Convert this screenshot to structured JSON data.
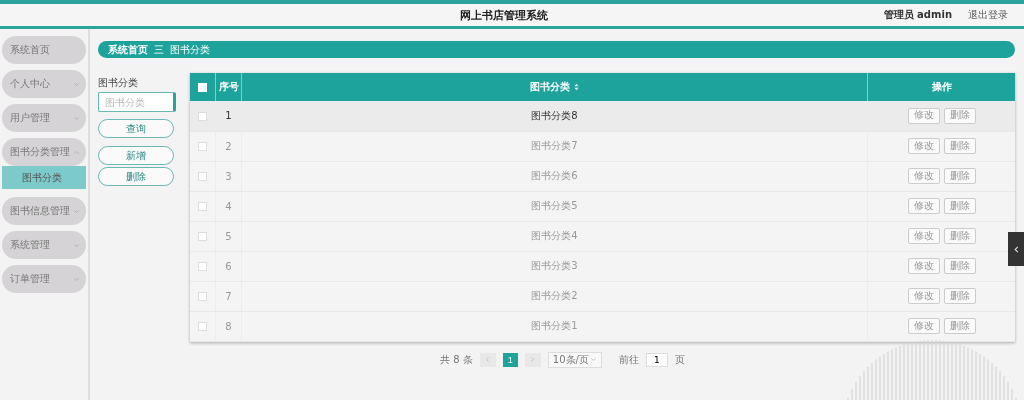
{
  "header": {
    "title": "网上书店管理系统",
    "user": "管理员 admin",
    "logout": "退出登录"
  },
  "sidebar": {
    "items": [
      {
        "label": "系统首页",
        "kind": "link"
      },
      {
        "label": "个人中心",
        "kind": "group",
        "expanded": false
      },
      {
        "label": "用户管理",
        "kind": "group",
        "expanded": false
      },
      {
        "label": "图书分类管理",
        "kind": "group",
        "expanded": true,
        "children": [
          {
            "label": "图书分类",
            "selected": true
          }
        ]
      },
      {
        "label": "图书信息管理",
        "kind": "group",
        "expanded": false
      },
      {
        "label": "系统管理",
        "kind": "group",
        "expanded": false
      },
      {
        "label": "订单管理",
        "kind": "group",
        "expanded": false
      }
    ]
  },
  "breadcrumb": [
    "系统首页",
    "图书分类"
  ],
  "breadcrumb_separator": "三",
  "search": {
    "label": "图书分类",
    "placeholder": "图书分类",
    "button": "查询"
  },
  "actions": [
    "新增",
    "删除"
  ],
  "table": {
    "all_checked": false,
    "columns": [
      "序号",
      "图书分类",
      "操作"
    ],
    "rows": [
      {
        "index": "1",
        "category": "图书分类8",
        "hovered": true,
        "checked": false,
        "actions": [
          "修改",
          "删除"
        ]
      },
      {
        "index": "2",
        "category": "图书分类7",
        "hovered": false,
        "checked": false,
        "actions": [
          "修改",
          "删除"
        ]
      },
      {
        "index": "3",
        "category": "图书分类6",
        "hovered": false,
        "checked": false,
        "actions": [
          "修改",
          "删除"
        ]
      },
      {
        "index": "4",
        "category": "图书分类5",
        "hovered": false,
        "checked": false,
        "actions": [
          "修改",
          "删除"
        ]
      },
      {
        "index": "5",
        "category": "图书分类4",
        "hovered": false,
        "checked": false,
        "actions": [
          "修改",
          "删除"
        ]
      },
      {
        "index": "6",
        "category": "图书分类3",
        "hovered": false,
        "checked": false,
        "actions": [
          "修改",
          "删除"
        ]
      },
      {
        "index": "7",
        "category": "图书分类2",
        "hovered": false,
        "checked": false,
        "actions": [
          "修改",
          "删除"
        ]
      },
      {
        "index": "8",
        "category": "图书分类1",
        "hovered": false,
        "checked": false,
        "actions": [
          "修改",
          "删除"
        ]
      }
    ]
  },
  "pagination": {
    "total": "共 8 条",
    "pages": [
      {
        "label": "1",
        "selected": true
      }
    ],
    "page_size": "10条/页",
    "goto_label": "前往",
    "goto_value": "1",
    "goto_suffix": "页"
  }
}
